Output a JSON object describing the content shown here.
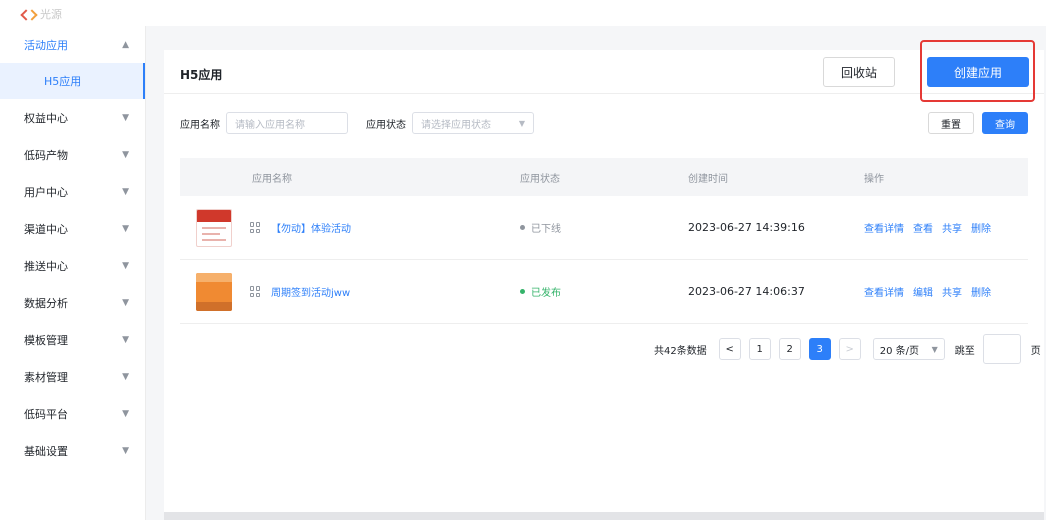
{
  "topbar": {
    "logo_text": "光源"
  },
  "sidebar": {
    "items": [
      {
        "label": "活动应用",
        "chevron": "▲",
        "open": true
      },
      {
        "label": "H5应用",
        "sub": true
      },
      {
        "label": "权益中心",
        "chevron": "▼"
      },
      {
        "label": "低码产物",
        "chevron": "▼"
      },
      {
        "label": "用户中心",
        "chevron": "▼"
      },
      {
        "label": "渠道中心",
        "chevron": "▼"
      },
      {
        "label": "推送中心",
        "chevron": "▼"
      },
      {
        "label": "数据分析",
        "chevron": "▼"
      },
      {
        "label": "模板管理",
        "chevron": "▼"
      },
      {
        "label": "素材管理",
        "chevron": "▼"
      },
      {
        "label": "低码平台",
        "chevron": "▼"
      },
      {
        "label": "基础设置",
        "chevron": "▼"
      }
    ]
  },
  "header": {
    "title": "H5应用",
    "recycle_label": "回收站",
    "create_label": "创建应用"
  },
  "filters": {
    "name_label": "应用名称",
    "name_placeholder": "请输入应用名称",
    "status_label": "应用状态",
    "status_placeholder": "请选择应用状态",
    "reset_label": "重置",
    "query_label": "查询"
  },
  "table": {
    "headers": [
      "应用名称",
      "应用状态",
      "创建时间",
      "操作"
    ],
    "rows": [
      {
        "name": "【勿动】体验活动",
        "status": "已下线",
        "status_color": "#8f959e",
        "created": "2023-06-27 14:39:16",
        "ops": [
          "查看详情",
          "查看",
          "共享",
          "删除"
        ],
        "thumb": "red"
      },
      {
        "name": "周期签到活动jww",
        "status": "已发布",
        "status_color": "#34b36a",
        "created": "2023-06-27 14:06:37",
        "ops": [
          "查看详情",
          "编辑",
          "共享",
          "删除"
        ],
        "thumb": "orange"
      }
    ]
  },
  "pagination": {
    "total_text": "共42条数据",
    "prev": "<",
    "next": ">",
    "pages": [
      "1",
      "2",
      "3"
    ],
    "current": "3",
    "page_size": "20 条/页",
    "jump_label": "跳至",
    "jump_suffix": "页"
  },
  "colors": {
    "accent": "#2d7ff9",
    "highlight": "#e53935"
  }
}
